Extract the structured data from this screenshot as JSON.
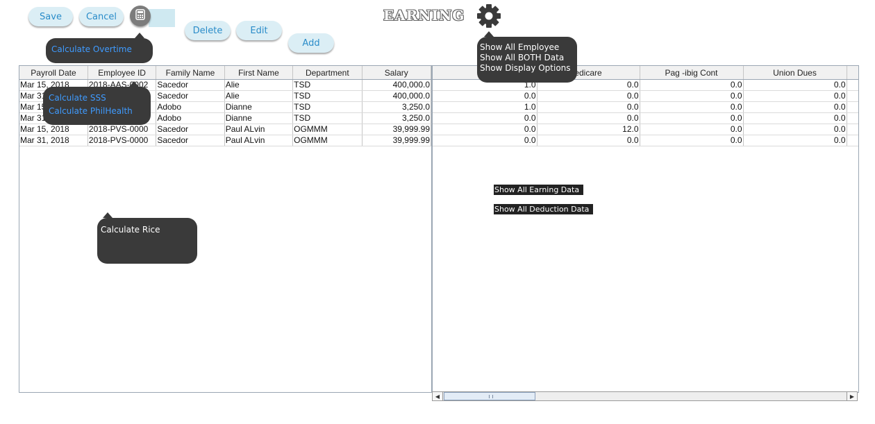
{
  "toolbar": {
    "save_label": "Save",
    "cancel_label": "Cancel",
    "delete_label": "Delete",
    "edit_label": "Edit",
    "add_label": "Add",
    "calculator_icon": "calculator-icon"
  },
  "header": {
    "title": "EARNING",
    "settings_icon": "gear-icon"
  },
  "menus": {
    "overtime": [
      "Calculate Overtime"
    ],
    "deductions": [
      "Calculate SSS",
      "Calculate PhilHealth"
    ],
    "rice": [
      "Calculate Rice"
    ],
    "display": [
      "Show All Employee",
      "Show All BOTH Data",
      "Show Display Options"
    ],
    "data_filters": [
      "Show All Earning Data",
      "Show All Deduction Data"
    ]
  },
  "left_table": {
    "columns": [
      "Payroll Date",
      "Employee ID",
      "Family Name",
      "First Name",
      "Department",
      "Salary"
    ],
    "rows": [
      [
        "Mar 15, 2018",
        "2018-AAS-0002",
        "Sacedor",
        "Alie",
        "TSD",
        "400,000.0"
      ],
      [
        "Mar 31",
        "",
        "Sacedor",
        "Alie",
        "TSD",
        "400,000.0"
      ],
      [
        "Mar 15",
        "",
        "Adobo",
        "Dianne",
        "TSD",
        "3,250.0"
      ],
      [
        "Mar 31",
        "",
        "Adobo",
        "Dianne",
        "TSD",
        "3,250.0"
      ],
      [
        "Mar 15, 2018",
        "2018-PVS-0000",
        "Sacedor",
        "Paul ALvin",
        "OGMMM",
        "39,999.99"
      ],
      [
        "Mar 31, 2018",
        "2018-PVS-0000",
        "Sacedor",
        "Paul ALvin",
        "OGMMM",
        "39,999.99"
      ]
    ]
  },
  "right_table": {
    "columns": [
      "Ss",
      "edicare",
      "Pag -ibig Cont",
      "Union Dues"
    ],
    "rows": [
      [
        "1.0",
        "0.0",
        "0.0",
        "0.0"
      ],
      [
        "0.0",
        "0.0",
        "0.0",
        "0.0"
      ],
      [
        "1.0",
        "0.0",
        "0.0",
        "0.0"
      ],
      [
        "0.0",
        "0.0",
        "0.0",
        "0.0"
      ],
      [
        "0.0",
        "12.0",
        "0.0",
        "0.0"
      ],
      [
        "0.0",
        "0.0",
        "0.0",
        "0.0"
      ]
    ]
  },
  "colors": {
    "button_bg": "#dbeef5",
    "button_text": "#2a8cc9",
    "tooltip_bg": "#3a3a3a",
    "menu_link": "#3f9bff"
  }
}
